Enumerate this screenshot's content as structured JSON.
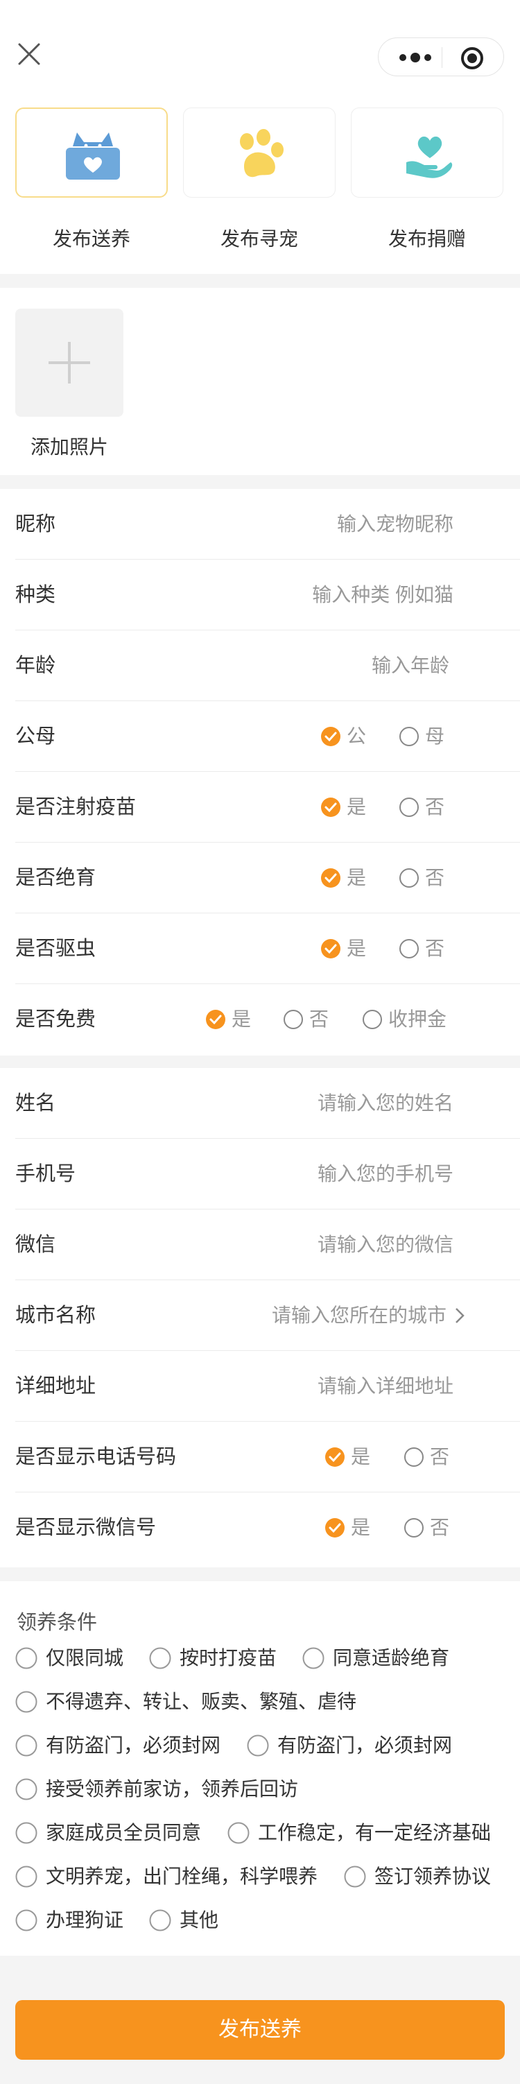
{
  "header": {
    "close_icon": "close-icon",
    "more_icon": "more-dots-icon",
    "target_icon": "record-icon"
  },
  "categories": [
    {
      "label": "发布送养",
      "icon": "cat-heart-box-icon",
      "color": "#6fa9dc",
      "active": true
    },
    {
      "label": "发布寻宠",
      "icon": "paw-icon",
      "color": "#f8d45c",
      "active": false
    },
    {
      "label": "发布捐赠",
      "icon": "heart-hand-icon",
      "color": "#5cc8c8",
      "active": false
    }
  ],
  "photo": {
    "label": "添加照片"
  },
  "pet": {
    "nickname": {
      "label": "昵称",
      "placeholder": "输入宠物昵称"
    },
    "species": {
      "label": "种类",
      "placeholder": "输入种类 例如猫"
    },
    "age": {
      "label": "年龄",
      "placeholder": "输入年龄"
    },
    "gender": {
      "label": "公母",
      "options": [
        "公",
        "母"
      ],
      "selected": "公"
    },
    "vaccine": {
      "label": "是否注射疫苗",
      "options": [
        "是",
        "否"
      ],
      "selected": "是"
    },
    "neutered": {
      "label": "是否绝育",
      "options": [
        "是",
        "否"
      ],
      "selected": "是"
    },
    "dewormed": {
      "label": "是否驱虫",
      "options": [
        "是",
        "否"
      ],
      "selected": "是"
    },
    "free": {
      "label": "是否免费",
      "options": [
        "是",
        "否",
        "收押金"
      ],
      "selected": "是"
    }
  },
  "contact": {
    "name": {
      "label": "姓名",
      "placeholder": "请输入您的姓名"
    },
    "phone": {
      "label": "手机号",
      "placeholder": "输入您的手机号"
    },
    "wechat": {
      "label": "微信",
      "placeholder": "请输入您的微信"
    },
    "city": {
      "label": "城市名称",
      "placeholder": "请输入您所在的城市"
    },
    "address": {
      "label": "详细地址",
      "placeholder": "请输入详细地址"
    },
    "show_phone": {
      "label": "是否显示电话号码",
      "options": [
        "是",
        "否"
      ],
      "selected": "是"
    },
    "show_wechat": {
      "label": "是否显示微信号",
      "options": [
        "是",
        "否"
      ],
      "selected": "是"
    }
  },
  "conditions": {
    "title": "领养条件",
    "items": [
      "仅限同城",
      "按时打疫苗",
      "同意适龄绝育",
      "不得遗弃、转让、贩卖、繁殖、虐待",
      "有防盗门，必须封网",
      "有防盗门，必须封网",
      "接受领养前家访，领养后回访",
      "家庭成员全员同意",
      "工作稳定，有一定经济基础",
      "文明养宠，出门栓绳，科学喂养",
      "签订领养协议",
      "办理狗证",
      "其他"
    ]
  },
  "submit": {
    "label": "发布送养"
  },
  "colors": {
    "accent": "#f7931e",
    "placeholder": "#999999",
    "card_active_border": "#f8dc8a"
  }
}
